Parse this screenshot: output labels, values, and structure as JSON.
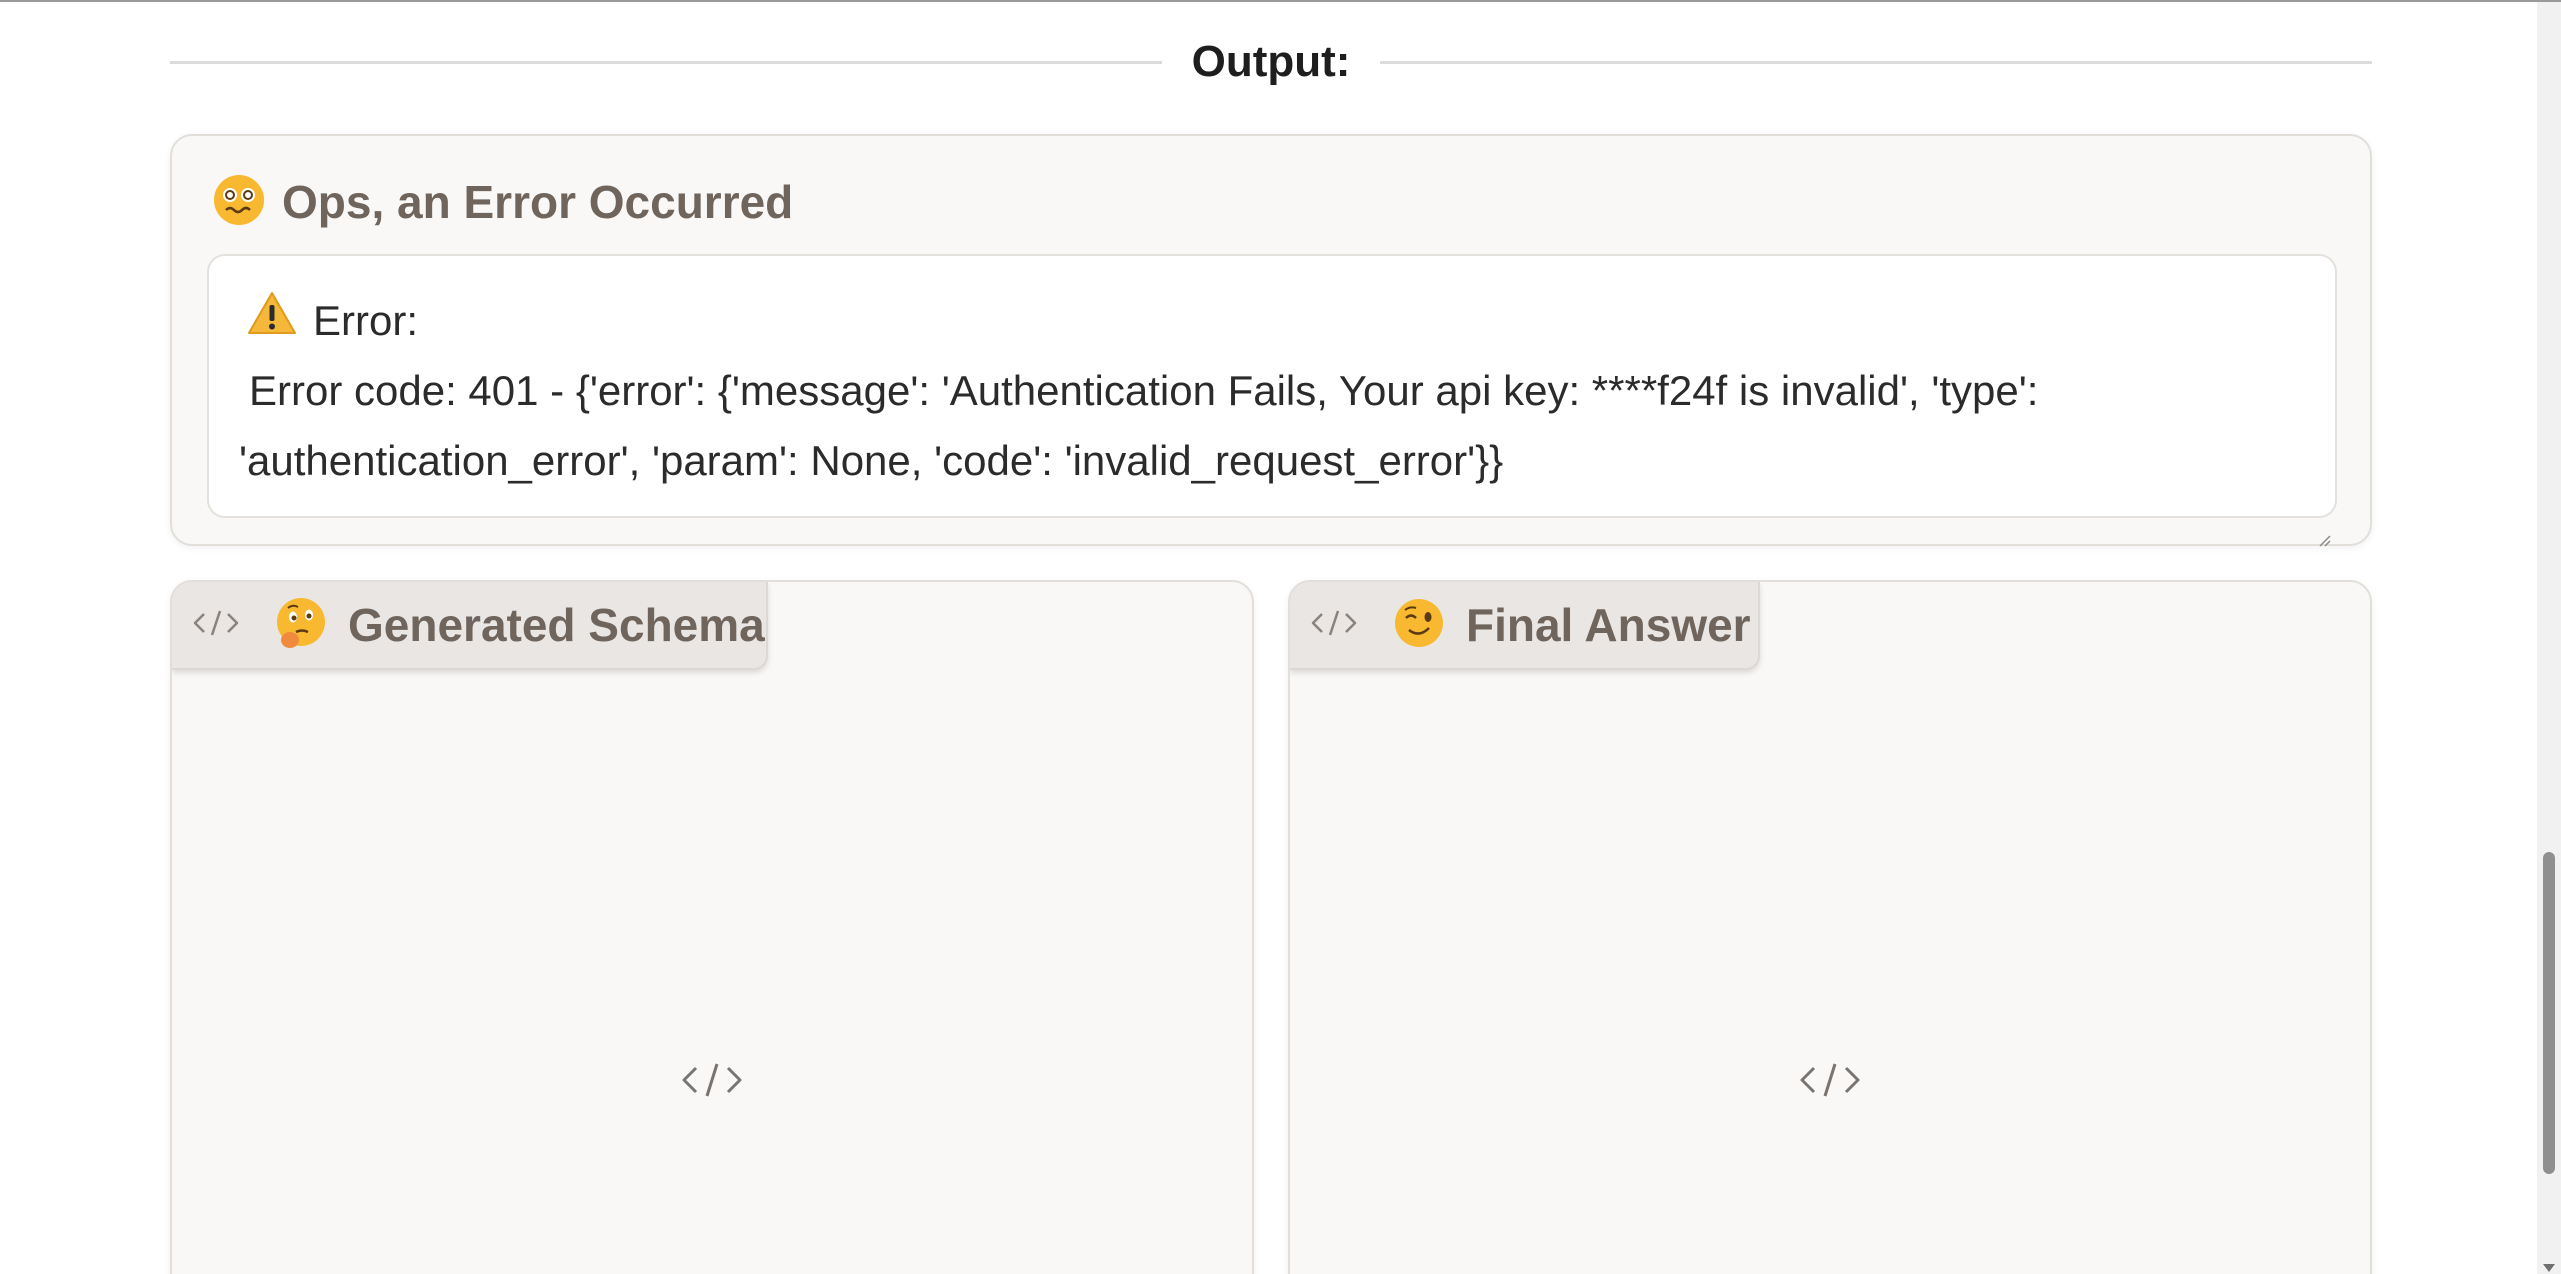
{
  "output": {
    "label": "Output:"
  },
  "error_card": {
    "title": "Ops, an Error Occurred",
    "title_icon": "dizzy-face-icon",
    "box": {
      "warning_icon": "warning-icon",
      "label": "Error:",
      "message": "Error code: 401 - {'error': {'message': 'Authentication Fails, Your api key: ****f24f is invalid', 'type': 'authentication_error', 'param': None, 'code': 'invalid_request_error'}}"
    }
  },
  "panels": {
    "schema": {
      "label": "Generated Schema",
      "emoji": "thinking-face-icon"
    },
    "answer": {
      "label": "Final Answer",
      "emoji": "winking-face-icon"
    }
  },
  "colors": {
    "card_bg": "#f9f8f6",
    "title_text": "#6f655d",
    "emoji_yellow": "#f8b830",
    "warning_yellow": "#f5b83a"
  }
}
